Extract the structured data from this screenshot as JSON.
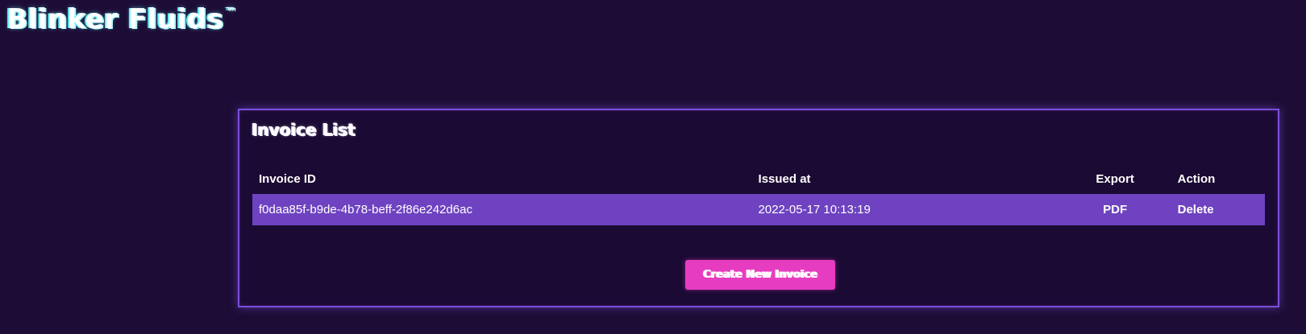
{
  "brand": {
    "name": "Blinker Fluids",
    "trademark": "™"
  },
  "invoice_list": {
    "title": "Invoice List",
    "columns": {
      "invoice_id": "Invoice ID",
      "issued_at": "Issued at",
      "export": "Export",
      "action": "Action"
    },
    "rows": [
      {
        "invoice_id": "f0daa85f-b9de-4b78-beff-2f86e242d6ac",
        "issued_at": "2022-05-17 10:13:19",
        "export": "PDF",
        "action": "Delete"
      }
    ],
    "create_button": "Create New Invoice"
  },
  "colors": {
    "background": "#1d0d36",
    "card_border": "#7a4fd9",
    "row_highlight": "#6e42c0",
    "button": "#e63cc0",
    "brand_glow": "#5ff1f5"
  }
}
